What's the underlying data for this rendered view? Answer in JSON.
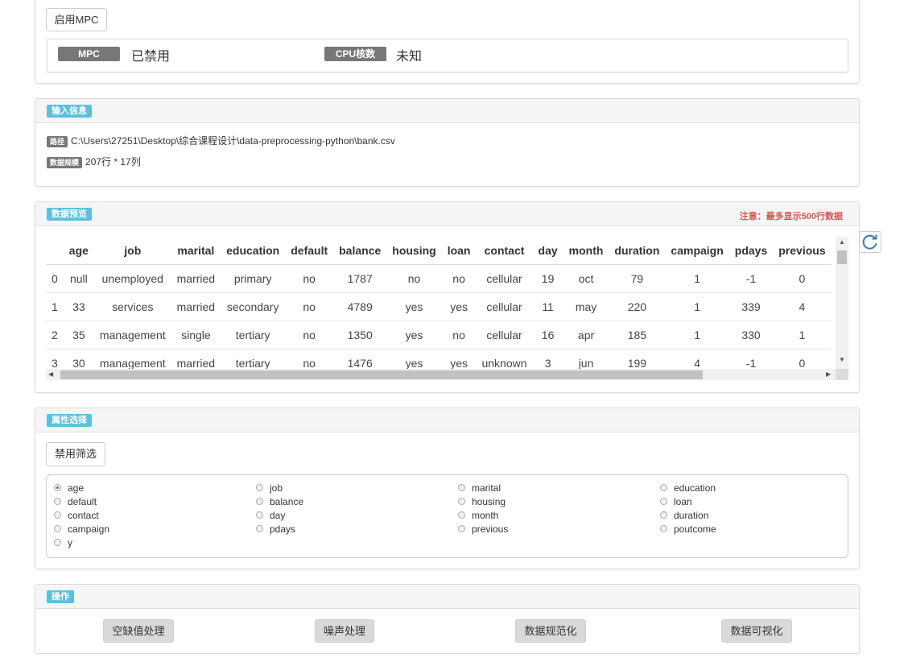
{
  "mpc": {
    "enable_button": "启用MPC",
    "mpc_label": "MPC",
    "mpc_value": "已禁用",
    "cpu_label": "CPU核数",
    "cpu_value": "未知"
  },
  "input_info": {
    "section_title": "输入信息",
    "path_label": "路径",
    "path_value": "C:\\Users\\27251\\Desktop\\综合课程设计\\data-preprocessing-python\\bank.csv",
    "size_label": "数据规模",
    "size_value": "207行 * 17列"
  },
  "preview": {
    "section_title": "数据预览",
    "note": "注意：最多显示500行数据",
    "columns": [
      "",
      "age",
      "job",
      "marital",
      "education",
      "default",
      "balance",
      "housing",
      "loan",
      "contact",
      "day",
      "month",
      "duration",
      "campaign",
      "pdays",
      "previous"
    ],
    "rows": [
      [
        "0",
        "null",
        "unemployed",
        "married",
        "primary",
        "no",
        "1787",
        "no",
        "no",
        "cellular",
        "19",
        "oct",
        "79",
        "1",
        "-1",
        "0"
      ],
      [
        "1",
        "33",
        "services",
        "married",
        "secondary",
        "no",
        "4789",
        "yes",
        "yes",
        "cellular",
        "11",
        "may",
        "220",
        "1",
        "339",
        "4"
      ],
      [
        "2",
        "35",
        "management",
        "single",
        "tertiary",
        "no",
        "1350",
        "yes",
        "no",
        "cellular",
        "16",
        "apr",
        "185",
        "1",
        "330",
        "1"
      ],
      [
        "3",
        "30",
        "management",
        "married",
        "tertiary",
        "no",
        "1476",
        "yes",
        "yes",
        "unknown",
        "3",
        "jun",
        "199",
        "4",
        "-1",
        "0"
      ]
    ]
  },
  "attributes": {
    "section_title": "属性选择",
    "filter_button": "禁用筛选",
    "options": [
      "age",
      "job",
      "marital",
      "education",
      "default",
      "balance",
      "housing",
      "loan",
      "contact",
      "day",
      "month",
      "duration",
      "campaign",
      "pdays",
      "previous",
      "poutcome",
      "y"
    ],
    "selected": "age"
  },
  "actions": {
    "section_title": "操作",
    "buttons": [
      "空缺值处理",
      "噪声处理",
      "数据规范化",
      "数据可视化"
    ]
  },
  "colors": {
    "section_tag": "#5bc0de",
    "label_gray": "#777777",
    "note_red": "#d9534f",
    "refresh_blue": "#337ab7"
  }
}
